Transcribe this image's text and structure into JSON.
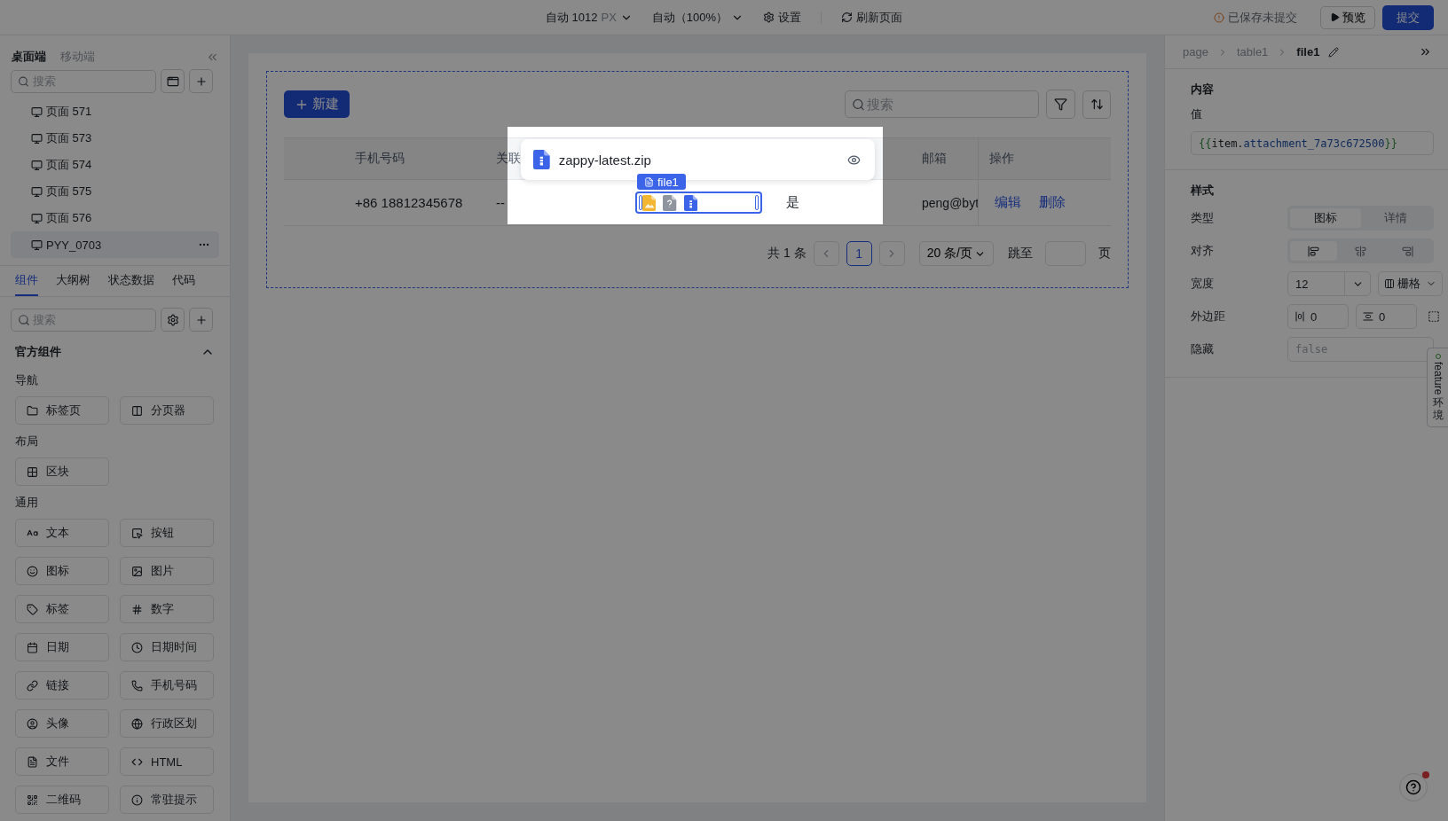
{
  "toolbar": {
    "width_mode": "自动 1012",
    "width_unit": "PX",
    "zoom": "自动（100%）",
    "settings": "设置",
    "refresh": "刷新页面",
    "save_status": "已保存未提交",
    "preview": "预览",
    "submit": "提交"
  },
  "sidebar": {
    "platform_tabs": [
      {
        "label": "桌面端",
        "selected": true
      },
      {
        "label": "移动端",
        "selected": false
      }
    ],
    "page_search": {
      "placeholder": "搜索"
    },
    "pages": [
      {
        "label": "页面 571",
        "selected": false
      },
      {
        "label": "页面 573",
        "selected": false
      },
      {
        "label": "页面 574",
        "selected": false
      },
      {
        "label": "页面 575",
        "selected": false
      },
      {
        "label": "页面 576",
        "selected": false
      },
      {
        "label": "PYY_0703",
        "selected": true
      }
    ],
    "panel_tabs": [
      {
        "label": "组件",
        "selected": true
      },
      {
        "label": "大纲树",
        "selected": false
      },
      {
        "label": "状态数据",
        "selected": false
      },
      {
        "label": "代码",
        "selected": false
      }
    ],
    "component_search": {
      "placeholder": "搜索"
    },
    "library": {
      "title": "官方组件",
      "expanded": true,
      "groups": [
        {
          "title": "导航",
          "items": [
            "标签页",
            "分页器"
          ]
        },
        {
          "title": "布局",
          "items": [
            "区块"
          ]
        },
        {
          "title": "通用",
          "items": [
            "文本",
            "按钮",
            "图标",
            "图片",
            "标签",
            "数字",
            "日期",
            "日期时间",
            "链接",
            "手机号码",
            "头像",
            "行政区划",
            "文件",
            "HTML",
            "二维码",
            "常驻提示"
          ]
        }
      ]
    }
  },
  "canvas": {
    "new_button": "新建",
    "search": {
      "placeholder": "搜索"
    },
    "table": {
      "columns": {
        "phone": "手机号码",
        "link": "关联",
        "email": "邮箱",
        "actions": "操作"
      },
      "rows": [
        {
          "phone": "+86 18812345678",
          "link": "--",
          "files": [
            {
              "kind": "image"
            },
            {
              "kind": "unknown"
            },
            {
              "kind": "archive"
            }
          ],
          "flag": "是",
          "email": "peng@byt",
          "actions": [
            "编辑",
            "删除"
          ]
        }
      ]
    },
    "popover": {
      "file_name": "zappy-latest.zip",
      "tag": "file1"
    },
    "pagination": {
      "total": "共 1 条",
      "pages": [
        {
          "label": "1",
          "selected": true
        }
      ],
      "page_size": "20 条/页",
      "jump_label": "跳至",
      "jump_suffix": "页"
    }
  },
  "inspector": {
    "breadcrumb": [
      "page",
      "table1",
      "file1"
    ],
    "content": {
      "title": "内容",
      "value_label": "值",
      "value_tokens": [
        {
          "text": "{{",
          "kind": "brace"
        },
        {
          "text": "item.",
          "kind": "variable"
        },
        {
          "text": "attachment_7a73c672500",
          "kind": "property"
        },
        {
          "text": "}}",
          "kind": "brace"
        }
      ]
    },
    "style": {
      "title": "样式",
      "type_label": "类型",
      "types": [
        {
          "label": "图标",
          "selected": true
        },
        {
          "label": "详情",
          "selected": false
        }
      ],
      "align_label": "对齐",
      "aligns": [
        {
          "selected": true
        },
        {
          "selected": false
        },
        {
          "selected": false
        }
      ],
      "width_label": "宽度",
      "width": {
        "value": "12",
        "unit": "栅格"
      },
      "margin_label": "外边距",
      "margins": [
        {
          "value": "0"
        },
        {
          "value": "0"
        }
      ],
      "hidden_label": "隐藏",
      "hidden": {
        "placeholder": "false"
      }
    }
  },
  "feature_tab": {
    "label": "feature",
    "env": "环境"
  }
}
